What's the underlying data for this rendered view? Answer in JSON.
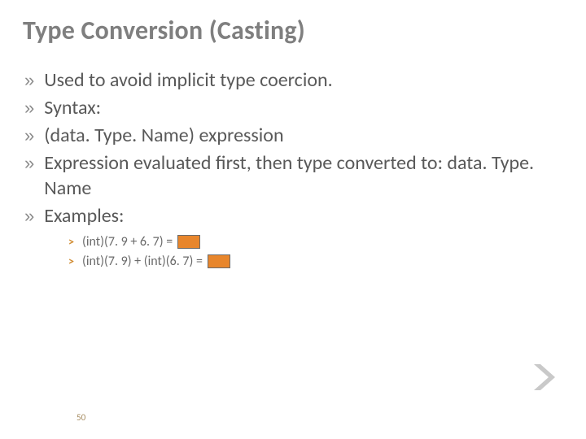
{
  "title": "Type Conversion (Casting)",
  "bullets": [
    "Used to avoid implicit type coercion.",
    "Syntax:",
    "      (data. Type. Name) expression",
    "Expression evaluated first, then type converted to: data. Type. Name",
    "Examples:"
  ],
  "examples": [
    "(int)(7. 9 + 6. 7) = ",
    "(int)(7. 9) + (int)(6. 7) = "
  ],
  "page_number": "50",
  "colors": {
    "title": "#7f7f7f",
    "body": "#595959",
    "accent": "#e8862c"
  }
}
